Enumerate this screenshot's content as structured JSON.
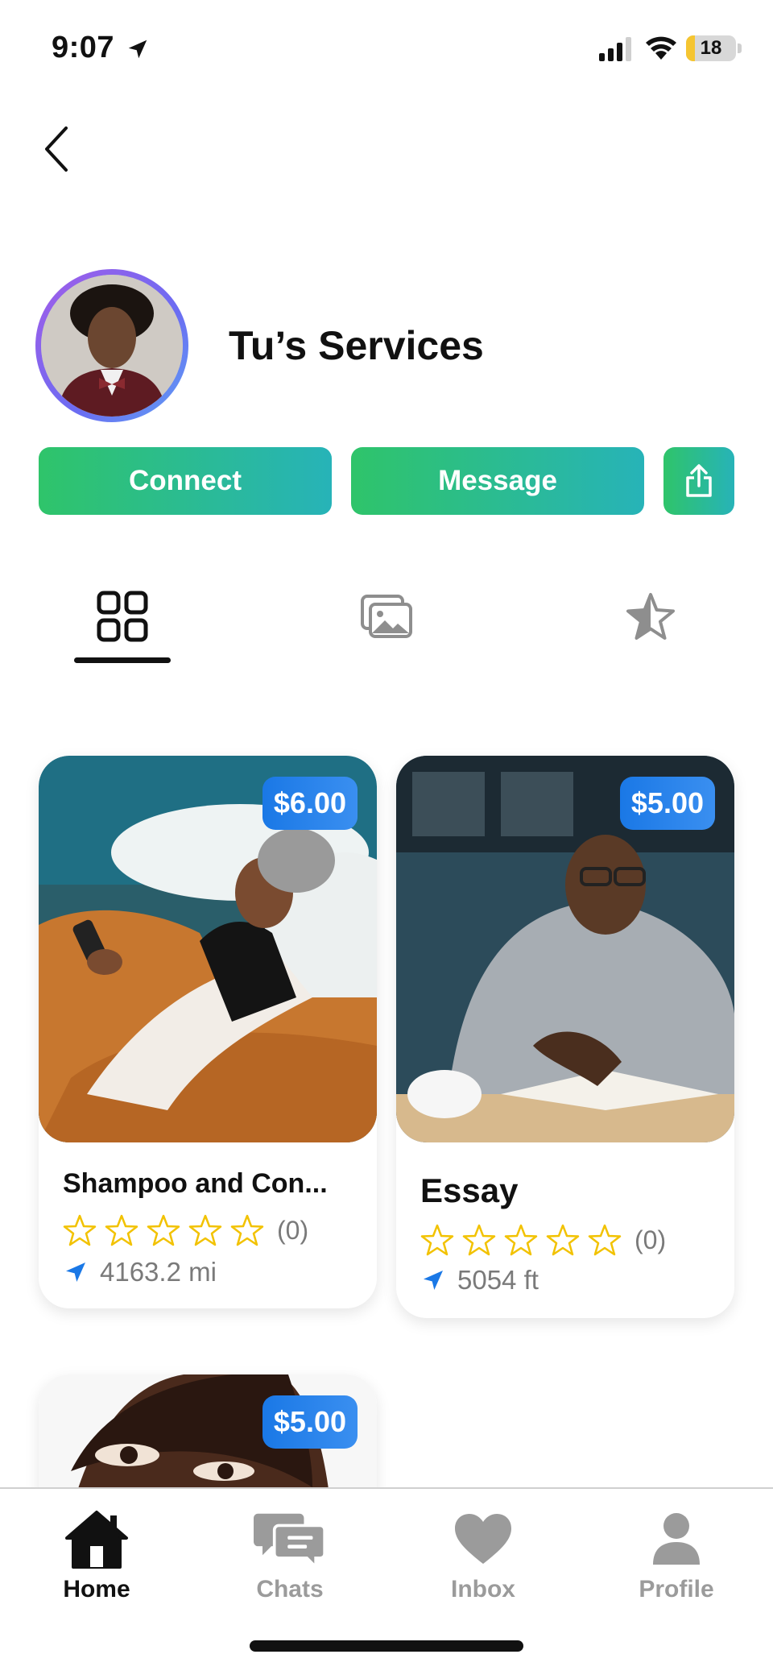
{
  "status_bar": {
    "time": "9:07",
    "battery": "18",
    "battery_level_pct": 18
  },
  "profile": {
    "name": "Tu’s Services"
  },
  "actions": {
    "connect_label": "Connect",
    "message_label": "Message"
  },
  "tabs": [
    {
      "icon": "grid-icon",
      "active": true
    },
    {
      "icon": "photos-icon",
      "active": false
    },
    {
      "icon": "star-icon",
      "active": false
    }
  ],
  "cards": [
    {
      "price": "$6.00",
      "title": "Shampoo and Con...",
      "rating_count": "(0)",
      "stars": 0,
      "distance": "4163.2 mi"
    },
    {
      "price": "$5.00",
      "title": "Essay",
      "rating_count": "(0)",
      "stars": 0,
      "distance": "5054 ft"
    },
    {
      "price": "$5.00"
    }
  ],
  "bottom_nav": {
    "home": "Home",
    "chats": "Chats",
    "inbox": "Inbox",
    "profile": "Profile"
  },
  "colors": {
    "button_gradient_start": "#2fc46a",
    "button_gradient_end": "#27b3b8",
    "price_badge": "#1a78e6",
    "star_outline": "#f2c200",
    "location_arrow": "#1a78e6",
    "inactive_nav": "#9b9b9b"
  }
}
